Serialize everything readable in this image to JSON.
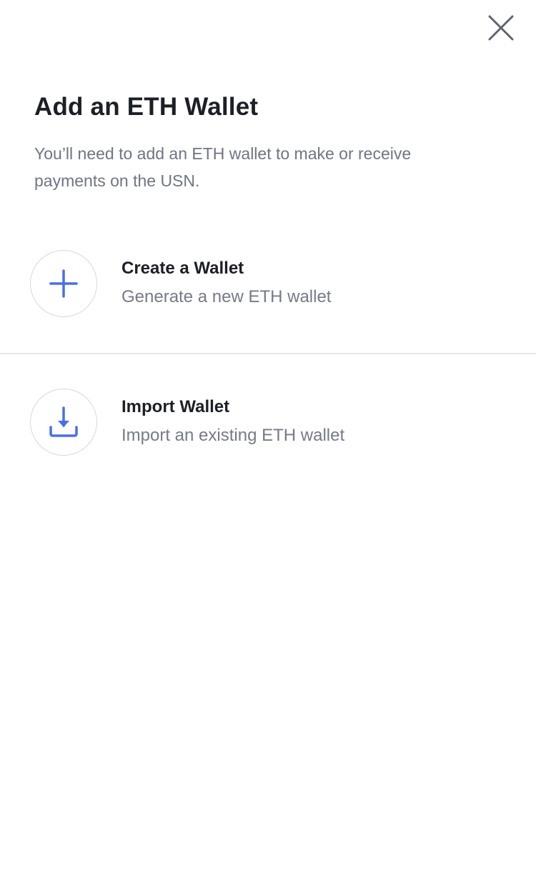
{
  "header": {
    "close_icon": "close-icon"
  },
  "main": {
    "title": "Add an ETH Wallet",
    "subtitle": "You’ll need to add an ETH wallet to make or receive payments on the USN."
  },
  "options": [
    {
      "icon": "plus-icon",
      "title": "Create a Wallet",
      "description": "Generate a new ETH wallet"
    },
    {
      "icon": "download-icon",
      "title": "Import Wallet",
      "description": "Import an existing ETH wallet"
    }
  ],
  "colors": {
    "accent": "#4a6ee8",
    "title_text": "#1c1f26",
    "secondary_text": "#6f7582",
    "circle_border": "#d6d8de",
    "divider": "#e6e7ea",
    "close_icon": "#5e6470"
  }
}
